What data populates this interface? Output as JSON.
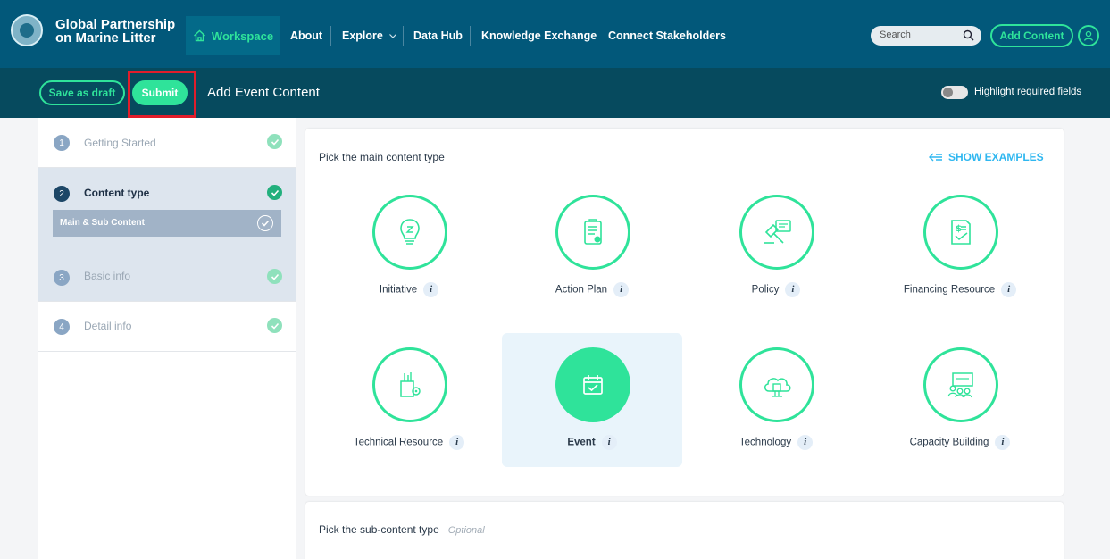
{
  "nav": {
    "brand_line1": "Global Partnership",
    "brand_line2": "on Marine Litter",
    "workspace": "Workspace",
    "about": "About",
    "explore": "Explore",
    "data_hub": "Data Hub",
    "knowledge_exchange": "Knowledge Exchange",
    "connect_stakeholders": "Connect Stakeholders",
    "search_placeholder": "Search",
    "add_content": "Add Content"
  },
  "action_bar": {
    "save_draft": "Save as draft",
    "submit": "Submit",
    "title": "Add Event Content",
    "toggle_label": "Highlight required fields"
  },
  "steps": [
    {
      "num": "1",
      "label": "Getting Started"
    },
    {
      "num": "2",
      "label": "Content type",
      "sub": "Main & Sub Content"
    },
    {
      "num": "3",
      "label": "Basic info"
    },
    {
      "num": "4",
      "label": "Detail info"
    }
  ],
  "main": {
    "title": "Pick the main content type",
    "show_examples": "SHOW EXAMPLES",
    "tiles": [
      {
        "label": "Initiative",
        "icon": "lightbulb-icon"
      },
      {
        "label": "Action Plan",
        "icon": "clipboard-icon"
      },
      {
        "label": "Policy",
        "icon": "gavel-icon"
      },
      {
        "label": "Financing Resource",
        "icon": "invoice-icon"
      },
      {
        "label": "Technical Resource",
        "icon": "tools-icon"
      },
      {
        "label": "Event",
        "icon": "calendar-icon",
        "selected": true
      },
      {
        "label": "Technology",
        "icon": "cloud-chip-icon"
      },
      {
        "label": "Capacity Building",
        "icon": "training-icon"
      }
    ],
    "info_glyph": "i"
  },
  "sub": {
    "title": "Pick the sub-content type",
    "optional": "Optional"
  },
  "colors": {
    "nav_bg": "#02587a",
    "action_bar_bg": "#064a5e",
    "accent_green": "#2fe39a",
    "link_blue": "#2fb7f0",
    "highlight_red": "#e11d2b"
  }
}
